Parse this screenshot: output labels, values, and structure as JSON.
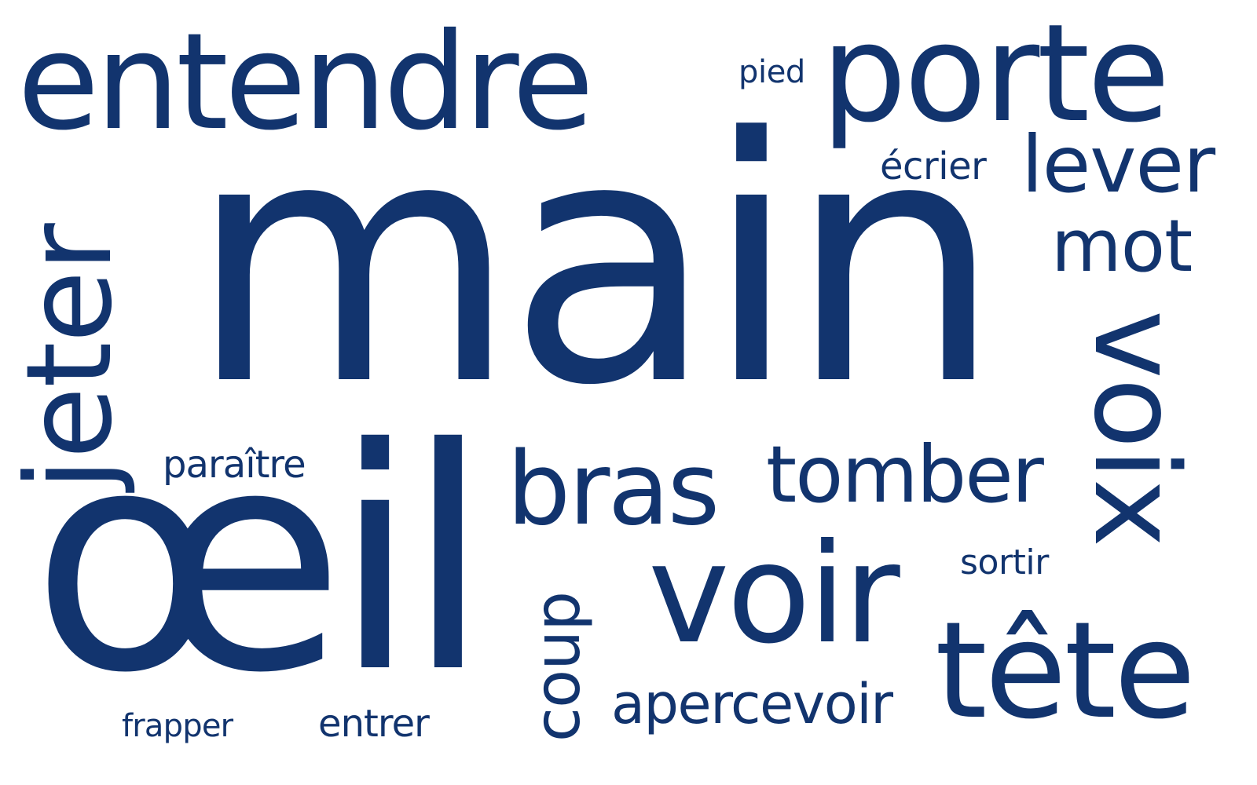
{
  "word_color": "#12346e",
  "background_color": "#ffffff",
  "words": {
    "main": "main",
    "oeil": "œil",
    "entendre": "entendre",
    "porte": "porte",
    "voir": "voir",
    "tete": "tête",
    "voix": "voix",
    "jeter": "jeter",
    "lever": "lever",
    "bras": "bras",
    "tomber": "tomber",
    "mot": "mot",
    "coup": "coup",
    "apercevoir": "apercevoir",
    "ecrier": "écrier",
    "pied": "pied",
    "paraitre": "paraître",
    "sortir": "sortir",
    "frapper": "frapper",
    "entrer": "entrer"
  }
}
